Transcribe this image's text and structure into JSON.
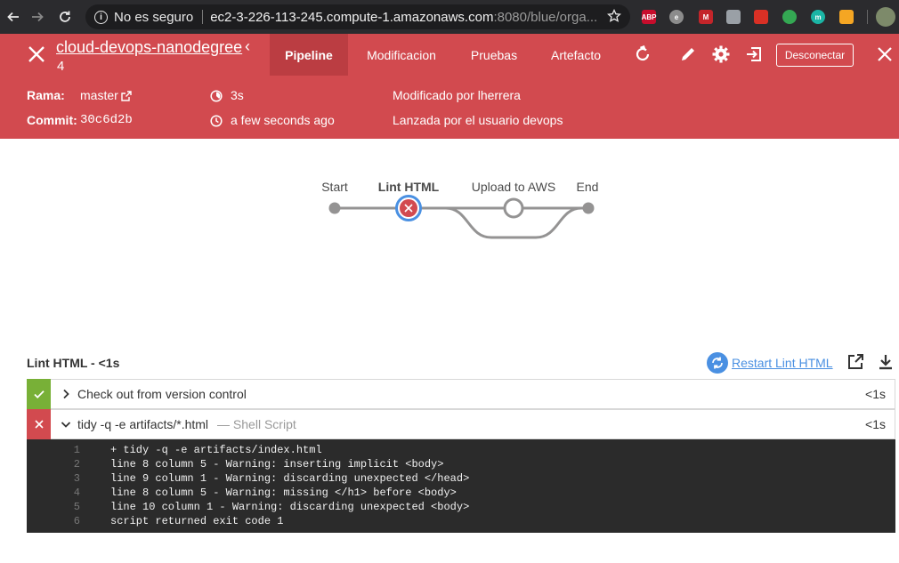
{
  "browser": {
    "security_label": "No es seguro",
    "url_host": "ec2-3-226-113-245.compute-1.amazonaws.com",
    "url_path": ":8080/blue/orga...",
    "extensions": [
      {
        "name": "adblock-plus-icon",
        "color": "#c70d2c",
        "text": "ABP"
      },
      {
        "name": "extension-e-icon",
        "color": "#8c8c8c",
        "text": "e"
      },
      {
        "name": "extension-m-icon",
        "color": "#c4252a",
        "text": "M"
      },
      {
        "name": "shield-extension-icon",
        "color": "#9aa0a6",
        "text": ""
      },
      {
        "name": "extension-red-icon",
        "color": "#d93025",
        "text": ""
      },
      {
        "name": "extension-ring-icon",
        "color": "#34a853",
        "text": ""
      },
      {
        "name": "extension-teal-icon",
        "color": "#1bb5a5",
        "text": "m"
      },
      {
        "name": "extension-tag-icon",
        "color": "#f5a623",
        "text": ""
      }
    ]
  },
  "header": {
    "title": "cloud-devops-nanodegree",
    "run_number": "4",
    "tabs": [
      {
        "label": "Pipeline",
        "active": true
      },
      {
        "label": "Modificacion",
        "active": false
      },
      {
        "label": "Pruebas",
        "active": false
      },
      {
        "label": "Artefacto",
        "active": false
      }
    ],
    "logout_label": "Desconectar",
    "branch_label": "Rama:",
    "branch_value": "master",
    "commit_label": "Commit:",
    "commit_value": "30c6d2b",
    "duration": "3s",
    "time_ago": "a few seconds ago",
    "modified_by": "Modificado por lherrera",
    "started_by": "Lanzada por el usuario devops"
  },
  "pipeline": {
    "stages": [
      {
        "label": "Start",
        "status": "start"
      },
      {
        "label": "Lint HTML",
        "status": "failed",
        "selected": true
      },
      {
        "label": "Upload to AWS",
        "status": "not-built"
      },
      {
        "label": "End",
        "status": "end"
      }
    ]
  },
  "steps": {
    "title": "Lint HTML - <1s",
    "restart_label": "Restart Lint HTML",
    "items": [
      {
        "name": "Check out from version control",
        "sub": "",
        "duration": "<1s",
        "status": "success",
        "expanded": false
      },
      {
        "name": "tidy -q -e artifacts/*.html",
        "sub": "— Shell Script",
        "duration": "<1s",
        "status": "failed",
        "expanded": true
      }
    ],
    "log": [
      {
        "n": "1",
        "text": "+ tidy -q -e artifacts/index.html"
      },
      {
        "n": "2",
        "text": "line 8 column 5 - Warning: inserting implicit <body>"
      },
      {
        "n": "3",
        "text": "line 9 column 1 - Warning: discarding unexpected </head>"
      },
      {
        "n": "4",
        "text": "line 8 column 5 - Warning: missing </h1> before <body>"
      },
      {
        "n": "5",
        "text": "line 10 column 1 - Warning: discarding unexpected <body>"
      },
      {
        "n": "6",
        "text": "script returned exit code 1"
      }
    ]
  },
  "colors": {
    "header_red": "#d24a4f",
    "active_tab": "#bb3d42",
    "success_green": "#78b037",
    "link_blue": "#4a90e2",
    "log_bg": "#2b2b2b"
  }
}
